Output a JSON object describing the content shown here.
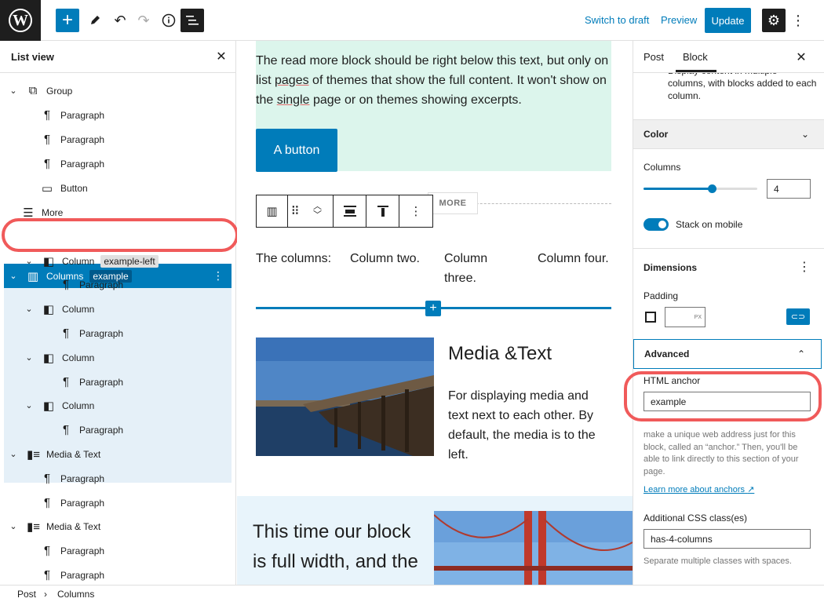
{
  "topbar": {
    "switch_to_draft": "Switch to draft",
    "preview": "Preview",
    "update": "Update",
    "accent": "#007cba"
  },
  "list_view": {
    "title": "List view",
    "rows": [
      {
        "label": "Group",
        "icon": "group-icon",
        "tag": ""
      },
      {
        "label": "Paragraph",
        "icon": "paragraph-icon",
        "tag": ""
      },
      {
        "label": "Paragraph",
        "icon": "paragraph-icon",
        "tag": ""
      },
      {
        "label": "Paragraph",
        "icon": "paragraph-icon",
        "tag": ""
      },
      {
        "label": "Button",
        "icon": "button-icon",
        "tag": ""
      },
      {
        "label": "More",
        "icon": "more-icon",
        "tag": ""
      },
      {
        "label": "Columns",
        "icon": "columns-icon",
        "tag": "example"
      },
      {
        "label": "Column",
        "icon": "column-icon",
        "tag": "example-left"
      },
      {
        "label": "Paragraph",
        "icon": "paragraph-icon",
        "tag": ""
      },
      {
        "label": "Column",
        "icon": "column-icon",
        "tag": ""
      },
      {
        "label": "Paragraph",
        "icon": "paragraph-icon",
        "tag": ""
      },
      {
        "label": "Column",
        "icon": "column-icon",
        "tag": ""
      },
      {
        "label": "Paragraph",
        "icon": "paragraph-icon",
        "tag": ""
      },
      {
        "label": "Column",
        "icon": "column-icon",
        "tag": ""
      },
      {
        "label": "Paragraph",
        "icon": "paragraph-icon",
        "tag": ""
      },
      {
        "label": "Media & Text",
        "icon": "media-text-icon",
        "tag": ""
      },
      {
        "label": "Paragraph",
        "icon": "paragraph-icon",
        "tag": ""
      },
      {
        "label": "Paragraph",
        "icon": "paragraph-icon",
        "tag": ""
      },
      {
        "label": "Media & Text",
        "icon": "media-text-icon",
        "tag": ""
      },
      {
        "label": "Paragraph",
        "icon": "paragraph-icon",
        "tag": ""
      },
      {
        "label": "Paragraph",
        "icon": "paragraph-icon",
        "tag": ""
      }
    ]
  },
  "canvas": {
    "intro_1": "The read more block should be right below this text, but only on",
    "intro_2a": "list ",
    "intro_2b": "pages",
    "intro_2c": " of themes that show the full content. It won't show on",
    "intro_3a": "the ",
    "intro_3b": "single",
    "intro_3c": " page or on themes showing excerpts.",
    "button_label": "A button",
    "more_label": "MORE",
    "col1": "The columns:",
    "col2": "Column two.",
    "col3": "Column three.",
    "col4": "Column four.",
    "media_heading": "Media &Text",
    "media_text": "For displaying media and text next to each other. By default, the media is to the left.",
    "full_width_heading": "This time our block is full width, and the"
  },
  "sidebar": {
    "tab_post": "Post",
    "tab_block": "Block",
    "block_desc": "Display content in multiple columns, with blocks added to each column.",
    "color_label": "Color",
    "columns_label": "Columns",
    "columns_value": "4",
    "columns_slider_fraction": 0.6,
    "stack_label": "Stack on mobile",
    "dimensions_label": "Dimensions",
    "padding_label": "Padding",
    "padding_unit": "PX",
    "advanced_label": "Advanced",
    "html_anchor_label": "HTML anchor",
    "html_anchor_value": "example",
    "anchor_help": "make a unique web address just for this block, called an “anchor.” Then, you'll be able to link directly to this section of your page.",
    "anchor_link": "Learn more about anchors",
    "css_label": "Additional CSS class(es)",
    "css_value": "has-4-columns",
    "css_help": "Separate multiple classes with spaces."
  },
  "breadcrumb": {
    "post": "Post",
    "columns": "Columns"
  }
}
